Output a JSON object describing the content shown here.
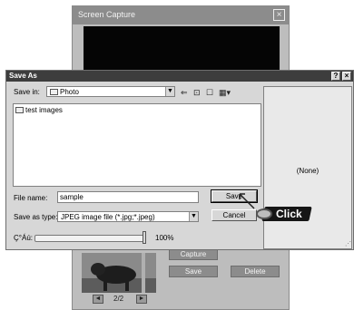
{
  "background_window": {
    "title": "Screen Capture",
    "close_label": "×",
    "capture_label": "Capture",
    "save_label": "Save",
    "delete_label": "Delete",
    "prev_label": "◄",
    "next_label": "►",
    "page_indicator": "2/2"
  },
  "dialog": {
    "title": "Save As",
    "help_label": "?",
    "close_label": "×",
    "save_in_label": "Save in:",
    "save_in_value": "Photo",
    "file_list": [
      "test images"
    ],
    "file_name_label": "File name:",
    "file_name_value": "sample",
    "save_as_type_label": "Save as type:",
    "save_as_type_value": "JPEG image file (*.jpg;*.jpeg)",
    "save_button": "Save",
    "cancel_button": "Cancel",
    "quality_label": "Ç°Áú:",
    "quality_value": "100%",
    "preview_text": "(None)"
  },
  "overlay": {
    "click_label": "Click"
  },
  "colors": {
    "title_bar": "#3d3d3d",
    "dialog_bg": "#d7d7d7",
    "background_window": "#bdbdbd"
  },
  "icons": [
    "folder-icon",
    "back-arrow-icon",
    "up-folder-icon",
    "new-folder-icon",
    "view-menu-icon"
  ]
}
